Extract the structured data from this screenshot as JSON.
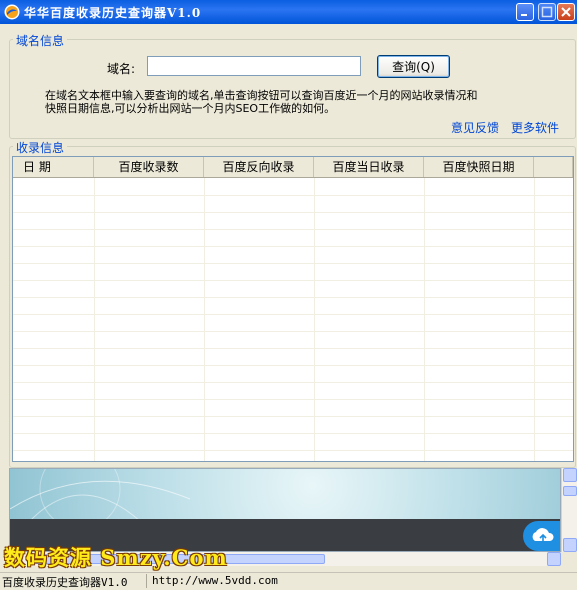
{
  "window": {
    "title": "华华百度收录历史查询器V1.0",
    "colors": {
      "titlebar": "#0A5FE0",
      "accent": "#0046D5",
      "watermark": "#FFEB1C"
    }
  },
  "domain_group": {
    "legend": "域名信息",
    "domain_label": "域名:",
    "domain_value": "",
    "query_button": "查询(Q)",
    "help_line1": "在域名文本框中输入要查询的域名,单击查询按钮可以查询百度近一个月的网站收录情况和",
    "help_line2": "快照日期信息,可以分析出网站一个月内SEO工作做的如何。",
    "feedback_link": "意见反馈",
    "more_link": "更多软件"
  },
  "index_group": {
    "legend": "收录信息",
    "columns": [
      "日 期",
      "百度收录数",
      "百度反向收录",
      "百度当日收录",
      "百度快照日期"
    ],
    "rows": []
  },
  "ad": {
    "icon": "cloud-upload-icon"
  },
  "watermark": "数码资源 Smzy.Com",
  "statusbar": {
    "app_name": "百度收录历史查询器V1.0",
    "url": "http://www.5vdd.com"
  }
}
